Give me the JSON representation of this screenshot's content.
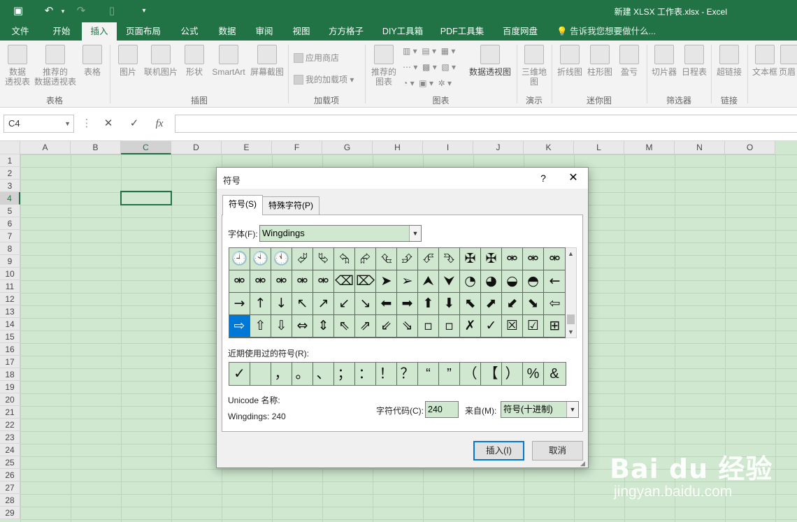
{
  "titlebar": {
    "document_title": "新建 XLSX 工作表.xlsx - Excel",
    "quick_access": {
      "save_icon": "save-icon",
      "undo_icon": "undo-icon",
      "redo_icon": "redo-icon",
      "new_icon": "new-file-icon",
      "customize_icon": "customize-icon"
    }
  },
  "ribbon_tabs": [
    "文件",
    "开始",
    "插入",
    "页面布局",
    "公式",
    "数据",
    "审阅",
    "视图",
    "方方格子",
    "DIY工具箱",
    "PDF工具集",
    "百度网盘"
  ],
  "ribbon_active_tab": "插入",
  "tell_me": "告诉我您想要做什么...",
  "ribbon": {
    "groups": [
      "表格",
      "插图",
      "加载项",
      "图表",
      "演示",
      "迷你图",
      "筛选器",
      "链接"
    ],
    "buttons": {
      "pivot_table": "数据\n透视表",
      "recommended_pivot": "推荐的\n数据透视表",
      "table": "表格",
      "picture": "图片",
      "online_picture": "联机图片",
      "shapes": "形状",
      "smartart": "SmartArt",
      "screenshot": "屏幕截图",
      "store": "应用商店",
      "my_addins": "我的加载项",
      "recommended_charts": "推荐的\n图表",
      "pivot_chart": "数据透视图",
      "map_3d": "三维地\n图",
      "line": "折线图",
      "column": "柱形图",
      "win_loss": "盈亏",
      "slicer": "切片器",
      "timeline": "日程表",
      "hyperlink": "超链接",
      "textbox": "文本框",
      "header_partial": "页眉"
    }
  },
  "formula_bar": {
    "name_box": "C4",
    "cancel": "✕",
    "enter": "✓",
    "fx": "fx",
    "formula": ""
  },
  "grid": {
    "columns": [
      "A",
      "B",
      "C",
      "D",
      "E",
      "F",
      "G",
      "H",
      "I",
      "J",
      "K",
      "L",
      "M",
      "N",
      "O"
    ],
    "rows": [
      "1",
      "2",
      "3",
      "4",
      "5",
      "6",
      "7",
      "8",
      "9",
      "10",
      "11",
      "12",
      "13",
      "14",
      "15",
      "16",
      "17",
      "18",
      "19",
      "20",
      "21",
      "22",
      "23",
      "24",
      "25",
      "26",
      "27",
      "28",
      "29"
    ],
    "selected_cell": "C4"
  },
  "dialog": {
    "title": "符号",
    "help": "?",
    "close": "✕",
    "tabs": [
      "符号(S)",
      "特殊字符(P)"
    ],
    "font_label": "字体(F):",
    "font_value": "Wingdings",
    "symbols": [
      [
        "🕘",
        "🕙",
        "🕚",
        "⮰",
        "⮱",
        "⮲",
        "⮳",
        "⮴",
        "⮵",
        "⮶",
        "⮷",
        "✠",
        "✠",
        "⚮",
        "⚮",
        "⚮"
      ],
      [
        "⚮",
        "⚮",
        "⚮",
        "⚮",
        "⚮",
        "⌫",
        "⌦",
        "➤",
        "➢",
        "⮝",
        "⮟",
        "◔",
        "◕",
        "◒",
        "◓",
        "←"
      ],
      [
        "→",
        "↑",
        "↓",
        "↖",
        "↗",
        "↙",
        "↘",
        "⬅",
        "➡",
        "⬆",
        "⬇",
        "⬉",
        "⬈",
        "⬋",
        "⬊",
        "⇦"
      ],
      [
        "⇨",
        "⇧",
        "⇩",
        "⇔",
        "⇕",
        "⇖",
        "⇗",
        "⇙",
        "⇘",
        "▫",
        "▫",
        "✗",
        "✓",
        "☒",
        "☑",
        "⊞"
      ]
    ],
    "selected_symbol": "⇨",
    "recent_label": "近期使用过的符号(R):",
    "recent": [
      "✓",
      "",
      "，",
      "。",
      "、",
      "；",
      "：",
      "！",
      "？",
      "“",
      "”",
      "（",
      "【",
      "）",
      "%",
      "&"
    ],
    "unicode_name_label": "Unicode 名称:",
    "unicode_name": "Wingdings: 240",
    "charcode_label": "字符代码(C):",
    "charcode": "240",
    "from_label": "来自(M):",
    "from_value": "符号(十进制)",
    "insert": "插入(I)",
    "cancel": "取消"
  },
  "watermark": {
    "logo": "Bai du 经验",
    "url": "jingyan.baidu.com"
  }
}
